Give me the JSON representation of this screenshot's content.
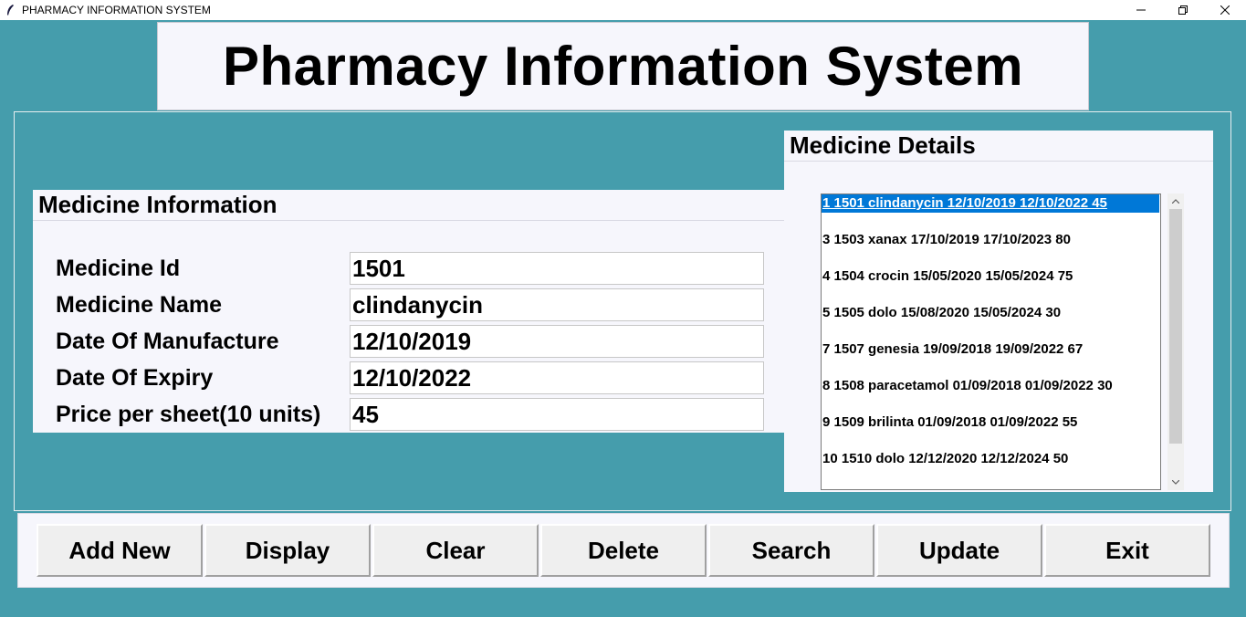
{
  "window": {
    "title": "PHARMACY INFORMATION SYSTEM",
    "minimize_icon": "minimize-icon",
    "restore_icon": "restore-icon",
    "close_icon": "close-icon"
  },
  "heading": "Pharmacy Information System",
  "info_panel": {
    "title": "Medicine Information",
    "fields": [
      {
        "label": "Medicine Id",
        "value": "1501"
      },
      {
        "label": "Medicine Name",
        "value": "clindanycin"
      },
      {
        "label": "Date Of Manufacture",
        "value": "12/10/2019"
      },
      {
        "label": "Date Of Expiry",
        "value": "12/10/2022"
      },
      {
        "label": "Price per sheet(10 units)",
        "value": "45"
      }
    ]
  },
  "details_panel": {
    "title": "Medicine Details",
    "items": [
      "1 1501 clindanycin 12/10/2019 12/10/2022 45",
      "3 1503 xanax 17/10/2019 17/10/2023 80",
      "4 1504 crocin 15/05/2020 15/05/2024 75",
      "5 1505 dolo 15/08/2020 15/05/2024 30",
      "7 1507 genesia 19/09/2018 19/09/2022 67",
      "8 1508 paracetamol 01/09/2018 01/09/2022 30",
      "9 1509 brilinta 01/09/2018 01/09/2022 55",
      "10 1510 dolo 12/12/2020 12/12/2024 50"
    ],
    "selected_index": 0
  },
  "buttons": {
    "add_new": "Add New",
    "display": "Display",
    "clear": "Clear",
    "delete": "Delete",
    "search": "Search",
    "update": "Update",
    "exit": "Exit"
  },
  "colors": {
    "background": "#459dac",
    "panel": "#f6f6fc",
    "selection": "#0078d7"
  }
}
